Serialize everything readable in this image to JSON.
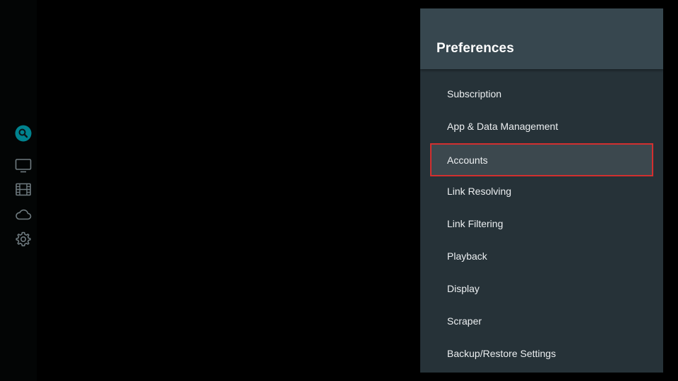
{
  "nav": {
    "items": [
      {
        "icon": "search-icon",
        "active": true
      },
      {
        "icon": "tv-icon",
        "active": false
      },
      {
        "icon": "film-icon",
        "active": false
      },
      {
        "icon": "cloud-icon",
        "active": false
      },
      {
        "icon": "gear-icon",
        "active": false
      }
    ],
    "active_color": "#00838f",
    "inactive_color": "#6f7b80"
  },
  "preferences": {
    "title": "Preferences",
    "items": [
      {
        "label": "Subscription"
      },
      {
        "label": "App & Data Management"
      },
      {
        "label": "Accounts",
        "selected": true
      },
      {
        "label": "Link Resolving"
      },
      {
        "label": "Link Filtering"
      },
      {
        "label": "Playback"
      },
      {
        "label": "Display"
      },
      {
        "label": "Scraper"
      },
      {
        "label": "Backup/Restore Settings"
      }
    ]
  },
  "colors": {
    "panel_bg": "#263238",
    "header_bg": "#37474f",
    "highlight_border": "#d32f2f"
  }
}
